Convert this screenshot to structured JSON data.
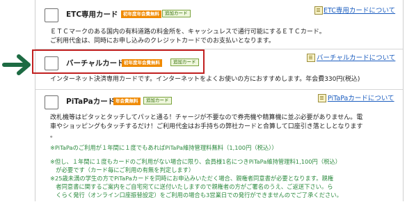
{
  "etc": {
    "title": "ETC専用カード",
    "badge_first_year": "初年度年会費無料",
    "badge_add": "追加カード",
    "link": "ETC専用カードについて",
    "desc_lines": [
      "ＥＴＣマークのある国内の有料道路の料金所を、キャッシュレスで通行可能にするＥＴＣカード。",
      "ご利用代金は、同時にお申し込みのクレジットカードでのお支払いとなります。"
    ]
  },
  "virtual": {
    "title": "バーチャルカード",
    "badge_first_year": "初年度年会費無料",
    "badge_add": "追加カード",
    "link": "バーチャルカードについて",
    "desc": "インターネット決済専用カードです。インターネットをよくお使いの方におすすめします。年会費330円(税込)"
  },
  "pitapa": {
    "title": "PiTaPaカード",
    "badge_free": "年会費無料",
    "badge_add": "追加カード",
    "link": "PiTaPaカードについて",
    "desc_lines": [
      "改札機等はピタッとタッチしてパッと通る！チャージが不要なので券売機や精算機に並ぶ必要がありません。電",
      "車やショッピングもタッチするだけ！ご利用代金はお手持ちの弊社カードと合算して口座引き落としとなります",
      "。"
    ],
    "notes": [
      "※PiTaPaのご利用が１年間に１度でもあればPiTaPa維持管理料無料（1,100円（税込））",
      "※但し、１年間に１度もカードのご利用がない場合に限り、会員様1名につきPiTaPa維持管理料1,100円（税込）",
      "　が必要です（カード毎にご利用の有無を判定します）",
      "※25歳未満の学生の方でPiTaPaカードを同時にお申込みいただく場合、親権者同意書が必要となります。親権",
      "　者同意書に関するご案内をご自宅宛てに送付いたしますので親権者の方がご署名のうえ、ご返送下さい。ら",
      "　くらく発行（オンライン口座振替設定）をご利用の場合も3営業日での発行ができませんのでご了承ください。"
    ]
  }
}
